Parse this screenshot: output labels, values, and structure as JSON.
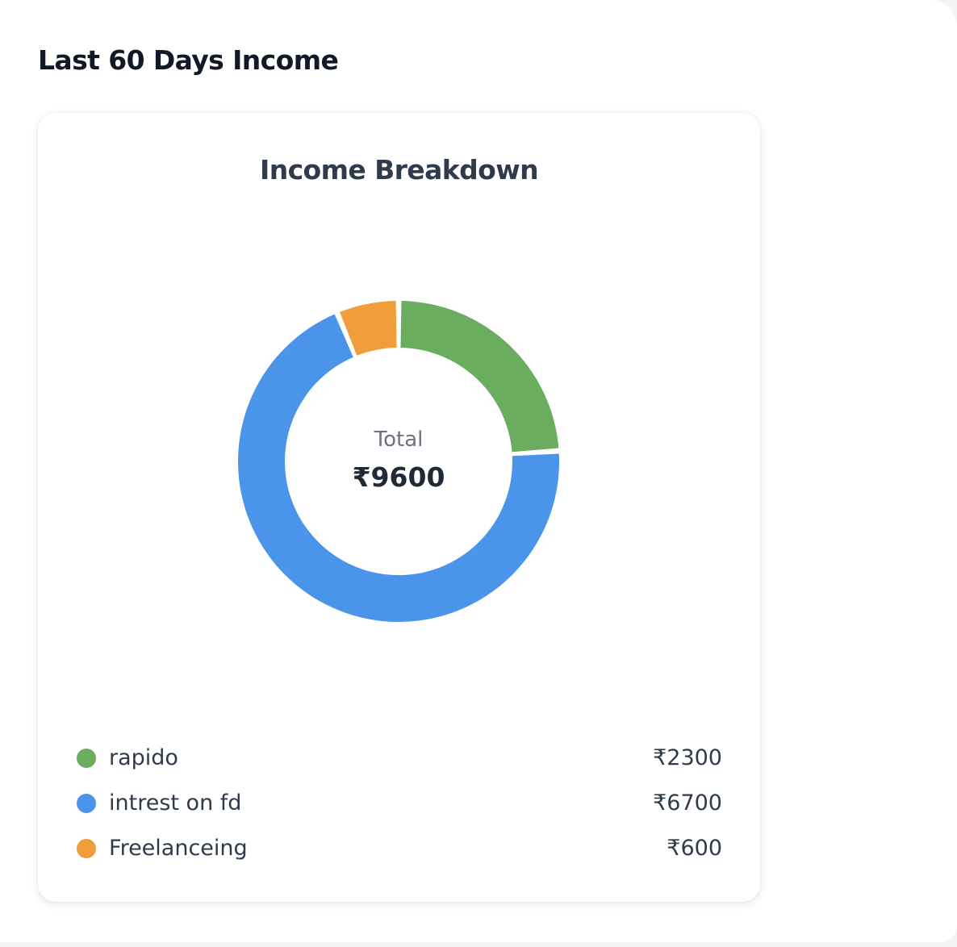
{
  "page": {
    "title": "Last 60 Days Income"
  },
  "card": {
    "title": "Income Breakdown",
    "center_label": "Total",
    "center_value": "₹9600"
  },
  "chart_data": {
    "type": "pie",
    "style": "donut",
    "title": "Income Breakdown",
    "categories": [
      "rapido",
      "intrest on fd",
      "Freelanceing"
    ],
    "values": [
      2300,
      6700,
      600
    ],
    "colors": [
      "#6aad5e",
      "#4a94ea",
      "#f09e3a"
    ],
    "value_labels": [
      "₹2300",
      "₹6700",
      "₹600"
    ],
    "total": 9600,
    "legend_position": "bottom"
  },
  "legend": {
    "items": [
      {
        "label": "rapido",
        "value": "₹2300",
        "color": "#6aad5e"
      },
      {
        "label": "intrest on fd",
        "value": "₹6700",
        "color": "#4a94ea"
      },
      {
        "label": "Freelanceing",
        "value": "₹600",
        "color": "#f09e3a"
      }
    ]
  }
}
